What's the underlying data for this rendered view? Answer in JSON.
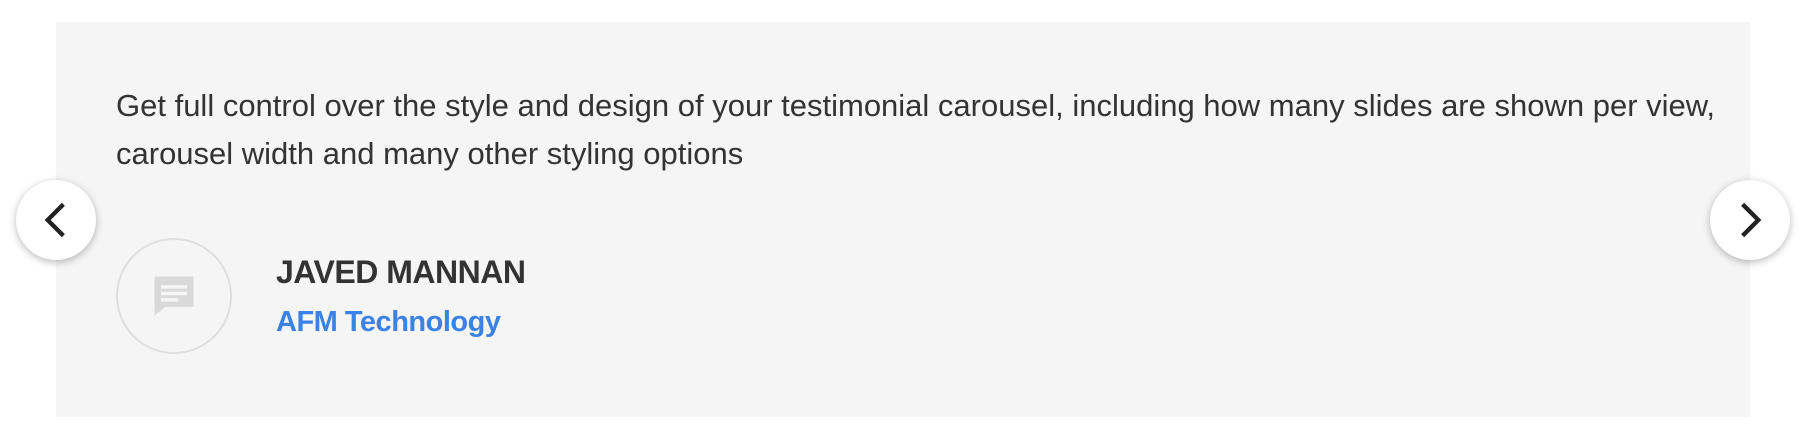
{
  "testimonial": {
    "quote": "Get full control over the style and design of your testimonial carousel, including how many slides are shown per view, carousel width and many other styling options",
    "author_name": "JAVED MANNAN",
    "author_company": "AFM Technology",
    "avatar_icon": "chat-bubble-icon"
  },
  "navigation": {
    "prev_icon": "chevron-left-icon",
    "next_icon": "chevron-right-icon"
  },
  "colors": {
    "card_background": "#f5f5f5",
    "text": "#333333",
    "accent": "#3b82e6"
  }
}
